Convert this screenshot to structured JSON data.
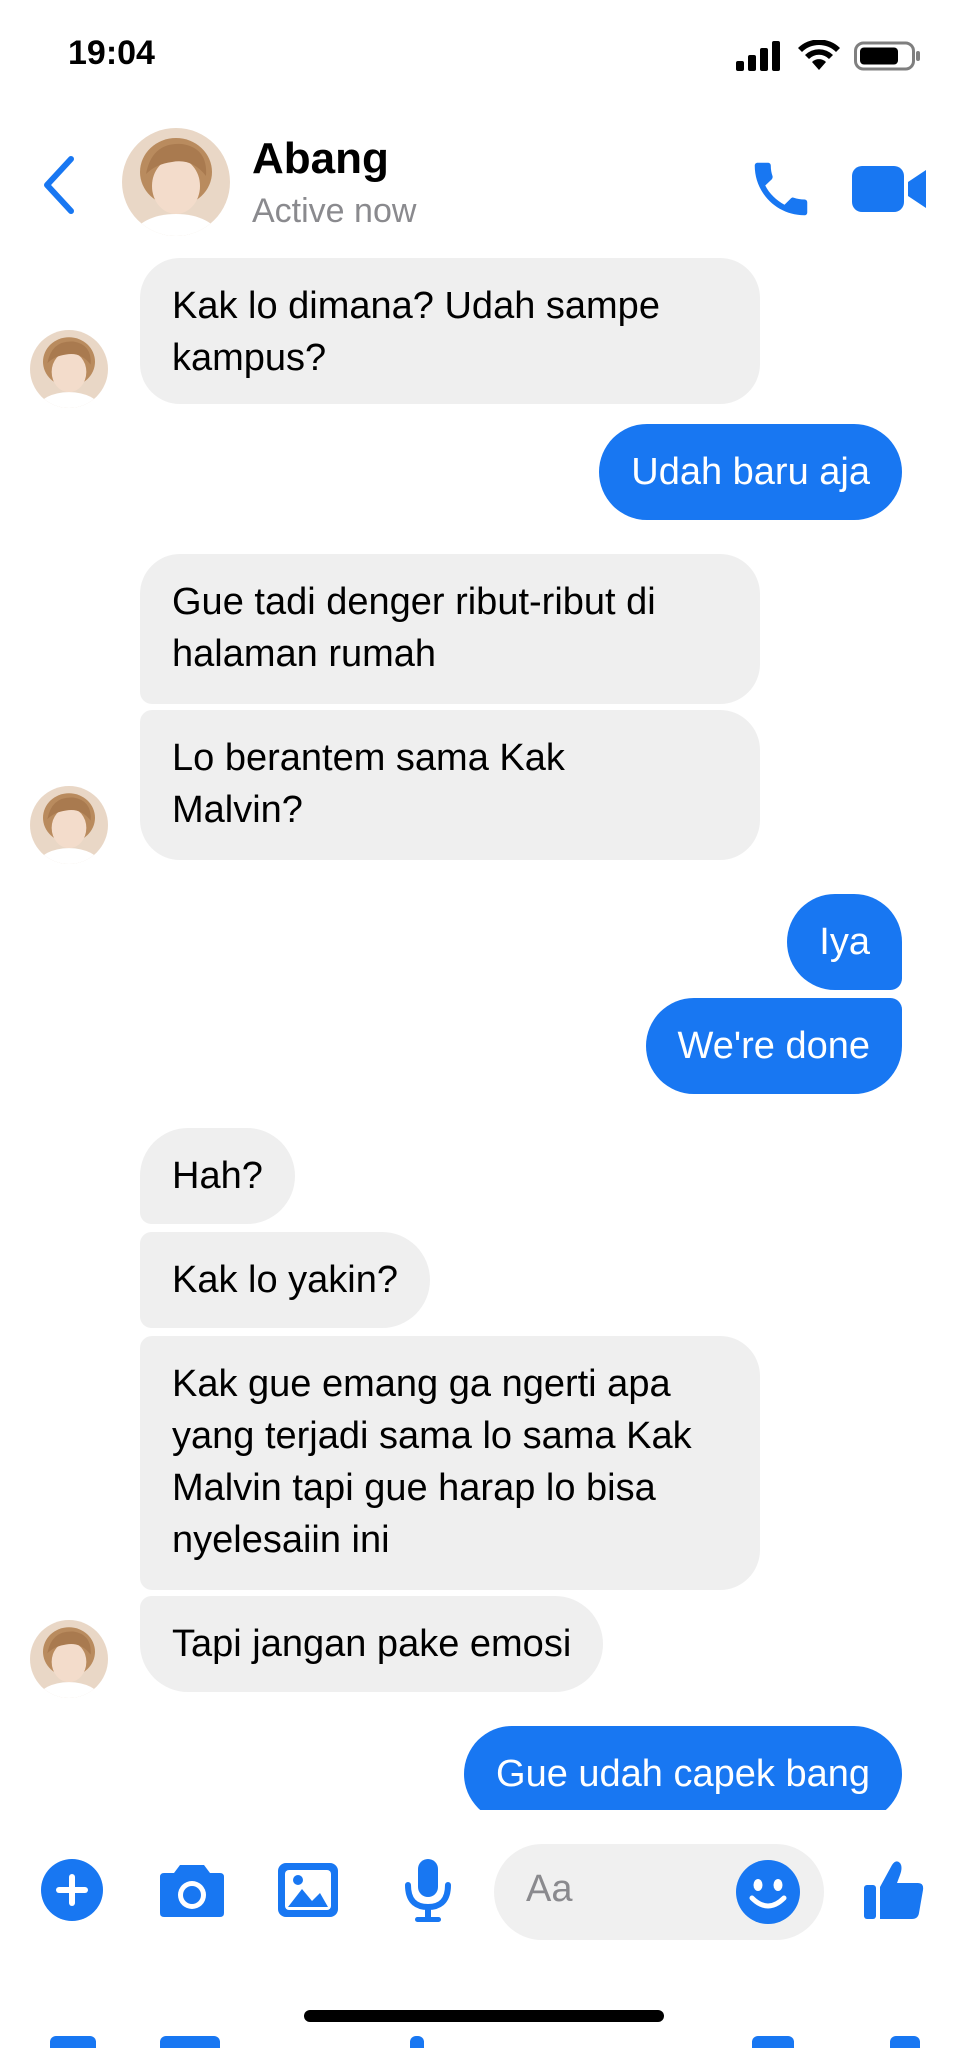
{
  "status_bar": {
    "time": "19:04"
  },
  "header": {
    "contact_name": "Abang",
    "contact_status": "Active now",
    "icons": [
      "back-chevron-icon",
      "contact-avatar",
      "phone-icon",
      "video-camera-icon"
    ]
  },
  "colors": {
    "accent": "#1877f2",
    "incoming_bubble": "#efefef",
    "muted_text": "#8a8a8e"
  },
  "messages": [
    {
      "from": "them",
      "text_lines": [
        "Kak lo dimana? Udah sampe",
        "kampus?"
      ]
    },
    {
      "from": "me",
      "text": "Udah baru aja"
    },
    {
      "from": "them",
      "text_lines": [
        "Gue tadi denger ribut-ribut di",
        "halaman rumah"
      ]
    },
    {
      "from": "them",
      "text_lines": [
        "Lo berantem sama Kak",
        "Malvin?"
      ]
    },
    {
      "from": "me",
      "text": "Iya"
    },
    {
      "from": "me",
      "text": "We're done"
    },
    {
      "from": "them",
      "text": "Hah?"
    },
    {
      "from": "them",
      "text": "Kak lo yakin?"
    },
    {
      "from": "them",
      "text_lines": [
        "Kak gue emang ga ngerti apa",
        "yang terjadi sama lo sama Kak",
        "Malvin tapi gue harap lo bisa",
        "nyelesaiin ini"
      ]
    },
    {
      "from": "them",
      "text": "Tapi jangan pake emosi"
    },
    {
      "from": "me",
      "text": "Gue udah capek bang"
    }
  ],
  "composer": {
    "placeholder": "Aa",
    "icons": [
      "plus-icon",
      "camera-icon",
      "image-icon",
      "microphone-icon",
      "emoji-icon",
      "thumbs-up-icon"
    ]
  }
}
